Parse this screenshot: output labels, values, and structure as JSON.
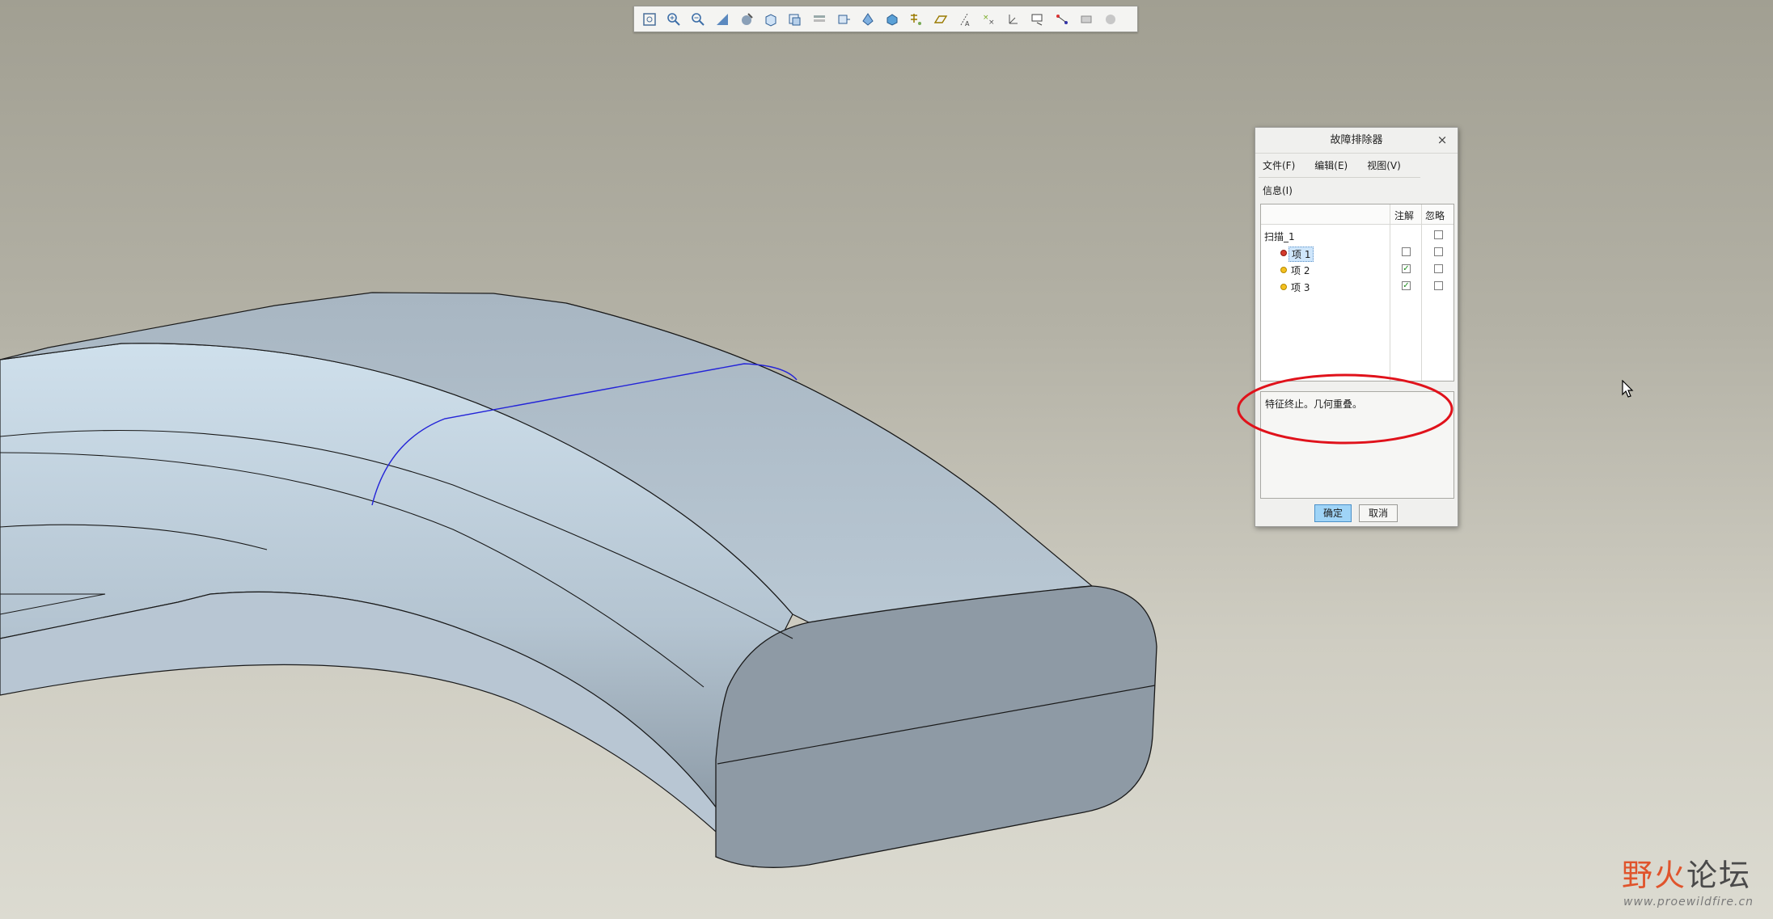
{
  "toolbar": {
    "icons": [
      "refit-icon",
      "zoom-in-icon",
      "zoom-out-icon",
      "repaint-icon",
      "shading-style-icon",
      "saved-orientations-icon",
      "view-manager-icon",
      "layer-icon",
      "spin-center-icon",
      "appearance-icon",
      "display-style-icon",
      "datum-display-icon",
      "plane-display-icon",
      "axis-display-icon",
      "point-display-icon",
      "csys-display-icon",
      "annotation-display-icon",
      "spin-icon",
      "perspective-icon",
      "help-icon"
    ]
  },
  "dialog": {
    "title": "故障排除器",
    "close": "×",
    "menus": [
      "文件(F)",
      "编辑(E)",
      "视图(V)"
    ],
    "menu_info": "信息(I)",
    "columns": {
      "note": "注解",
      "ignore": "忽略"
    },
    "tree": {
      "root": "扫描_1",
      "items": [
        {
          "label": "项 1",
          "status": "error",
          "note": false,
          "ignore": false
        },
        {
          "label": "项 2",
          "status": "warning",
          "note": true,
          "ignore": false
        },
        {
          "label": "项 3",
          "status": "warning",
          "note": true,
          "ignore": false
        }
      ],
      "root_ignore": false
    },
    "message": "特征终止。几何重叠。",
    "ok": "确定",
    "cancel": "取消"
  },
  "watermark": {
    "title_first": "野火",
    "title_rest": "论坛",
    "url": "www.proewildfire.cn"
  },
  "colors": {
    "highlight_ellipse": "#e0121b",
    "model_face": "#b7c6d2",
    "model_end": "#8f9aa4",
    "selection_edge": "#2323d8",
    "error_bullet": "#d43a2c",
    "warning_bullet": "#f4c020"
  }
}
